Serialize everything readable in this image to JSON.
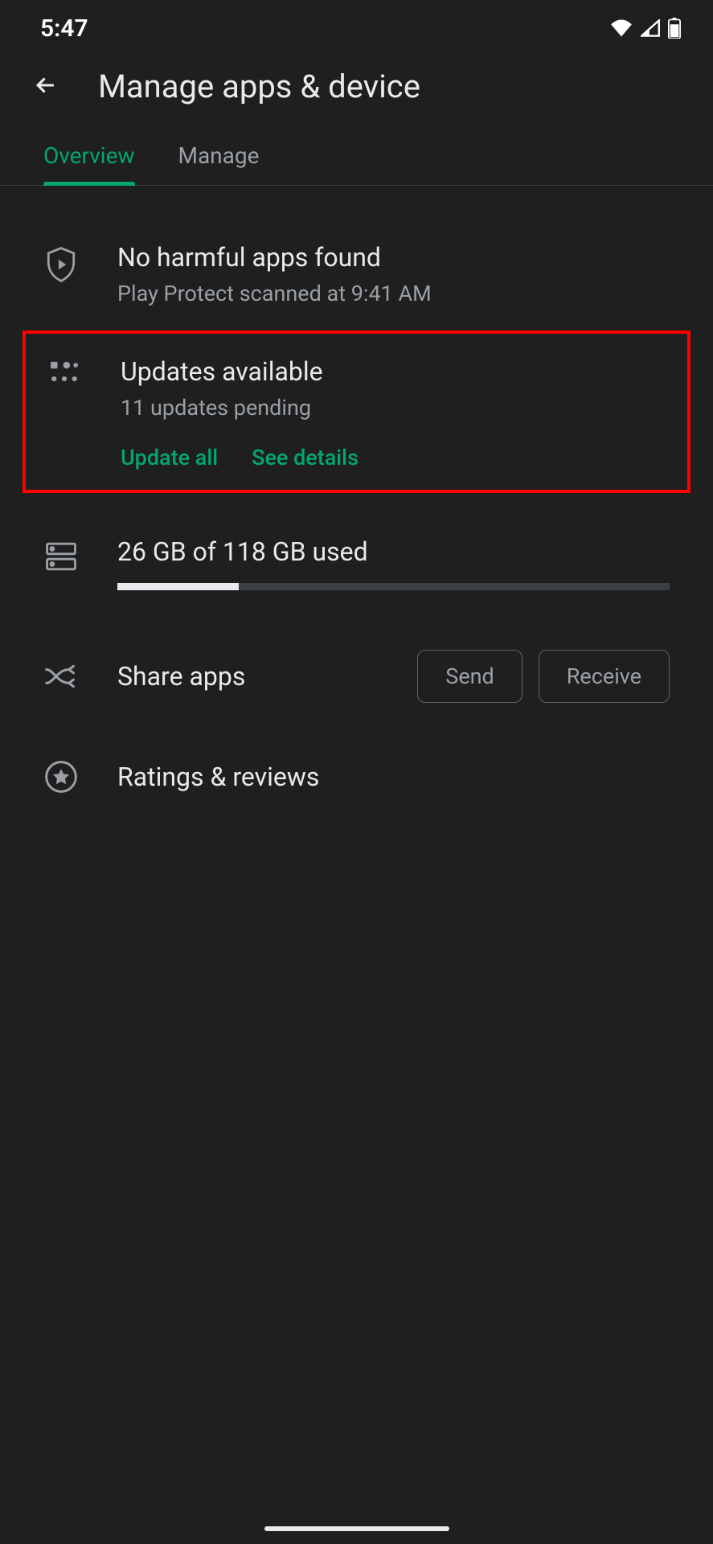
{
  "status": {
    "time": "5:47"
  },
  "header": {
    "title": "Manage apps & device"
  },
  "tabs": {
    "overview": "Overview",
    "manage": "Manage"
  },
  "protect": {
    "title": "No harmful apps found",
    "sub": "Play Protect scanned at 9:41 AM"
  },
  "updates": {
    "title": "Updates available",
    "sub": "11 updates pending",
    "update_all": "Update all",
    "see_details": "See details"
  },
  "storage": {
    "label": "26 GB of 118 GB used",
    "percent": 22
  },
  "share": {
    "label": "Share apps",
    "send": "Send",
    "receive": "Receive"
  },
  "ratings": {
    "label": "Ratings & reviews"
  }
}
